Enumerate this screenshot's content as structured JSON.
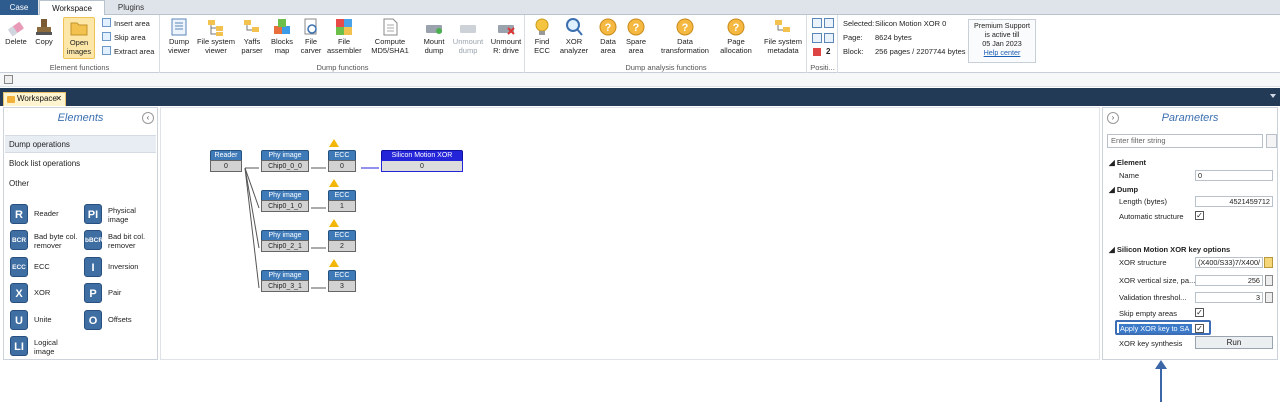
{
  "tabs": [
    {
      "label": "Case"
    },
    {
      "label": "Workspace"
    },
    {
      "label": "Plugins"
    }
  ],
  "ribbon": {
    "element_functions": {
      "label": "Element functions",
      "delete": "Delete",
      "copy": "Copy",
      "open_images": "Open images",
      "insert_area": "Insert area",
      "skip_area": "Skip area",
      "extract_area": "Extract area"
    },
    "dump_functions": {
      "label": "Dump functions",
      "dump_viewer": "Dump viewer",
      "fs_viewer": "File system viewer",
      "yaffs_parser": "Yaffs parser",
      "blocks_map": "Blocks map",
      "file_carver": "File carver",
      "file_assembler": "File assembler",
      "compute_md5": "Compute MD5/SHA1",
      "mount_dump": "Mount dump",
      "unmount_dump": "Unmount dump",
      "unmount_r": "Unmount R: drive"
    },
    "analysis": {
      "label": "Dump analysis functions",
      "find_ecc": "Find ECC",
      "xor_analyzer": "XOR analyzer",
      "data_area": "Data area",
      "spare_area": "Spare area",
      "data_transformation": "Data transformation",
      "page_allocation": "Page allocation",
      "fs_metadata": "File system metadata"
    },
    "position": {
      "label": "Positi...",
      "count": "2"
    },
    "selected": {
      "label": "Selected:",
      "value": "Silicon Motion XOR 0"
    },
    "page": {
      "label": "Page:",
      "value": "8624 bytes"
    },
    "block": {
      "label": "Block:",
      "value": "256 pages / 2207744 bytes"
    },
    "support": {
      "line1": "Premium Support",
      "line2": "is active till",
      "date": "05 Jan 2023",
      "link": "Help center"
    }
  },
  "workspace_tab": {
    "label": "Workspace",
    "close": "✕"
  },
  "elements_panel": {
    "title": "Elements",
    "categories": [
      "Dump operations",
      "Block list operations",
      "Other"
    ],
    "items": [
      {
        "badge": "R",
        "label": "Reader"
      },
      {
        "badge": "PI",
        "label": "Physical image"
      },
      {
        "badge": "BCR",
        "label": "Bad byte col. remover"
      },
      {
        "badge": "bBCR",
        "label": "Bad bit col. remover"
      },
      {
        "badge": "ECC",
        "label": "ECC"
      },
      {
        "badge": "I",
        "label": "Inversion"
      },
      {
        "badge": "X",
        "label": "XOR"
      },
      {
        "badge": "P",
        "label": "Pair"
      },
      {
        "badge": "U",
        "label": "Unite"
      },
      {
        "badge": "O",
        "label": "Offsets"
      },
      {
        "badge": "LI",
        "label": "Logical image"
      }
    ]
  },
  "graph": {
    "reader": {
      "title": "Reader",
      "value": "0"
    },
    "phy": [
      {
        "title": "Phy image",
        "value": "Chip0_0_0"
      },
      {
        "title": "Phy image",
        "value": "Chip0_1_0"
      },
      {
        "title": "Phy image",
        "value": "Chip0_2_1"
      },
      {
        "title": "Phy image",
        "value": "Chip0_3_1"
      }
    ],
    "ecc": [
      {
        "title": "ECC",
        "value": "0"
      },
      {
        "title": "ECC",
        "value": "1"
      },
      {
        "title": "ECC",
        "value": "2"
      },
      {
        "title": "ECC",
        "value": "3"
      }
    ],
    "xor": {
      "title": "Silicon Motion XOR",
      "value": "0"
    }
  },
  "parameters": {
    "title": "Parameters",
    "filter_placeholder": "Enter filter string",
    "element_section": "Element",
    "name_label": "Name",
    "name_value": "0",
    "dump_section": "Dump",
    "length_label": "Length (bytes)",
    "length_value": "4521459712",
    "auto_structure_label": "Automatic structure",
    "xor_section": "Silicon Motion XOR key options",
    "xor_structure_label": "XOR structure",
    "xor_structure_value": "(X400/S33)7/X400/",
    "xor_vertical_label": "XOR vertical size, pa...",
    "xor_vertical_value": "256",
    "validation_label": "Validation threshol...",
    "validation_value": "3",
    "skip_empty_label": "Skip empty areas",
    "apply_xor_label": "Apply XOR key to SA",
    "synthesis_label": "XOR key synthesis",
    "run_label": "Run"
  }
}
